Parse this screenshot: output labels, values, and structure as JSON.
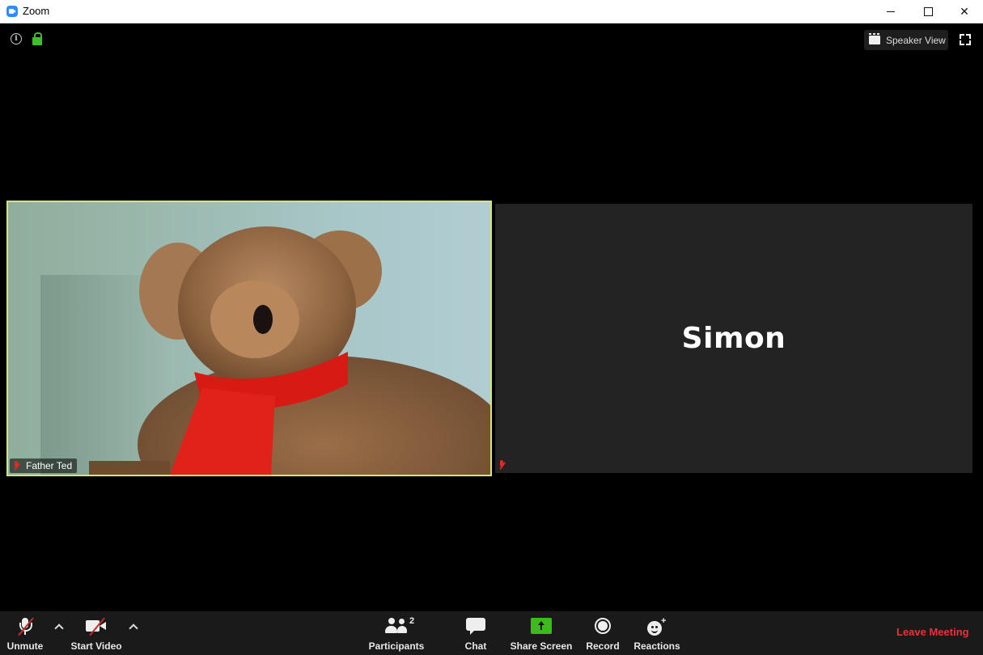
{
  "window": {
    "title": "Zoom",
    "controls": {
      "minimize": "minimize",
      "maximize": "maximize",
      "close": "close"
    }
  },
  "meeting_header": {
    "info_icon": "info-icon",
    "security_icon": "lock-icon",
    "view_toggle_label": "Speaker View",
    "fullscreen_icon": "fullscreen-icon"
  },
  "participants_tiles": [
    {
      "name": "Father Ted",
      "video_on": true,
      "muted": true,
      "active_speaker": true
    },
    {
      "name": "Simon",
      "video_on": false,
      "muted": true,
      "active_speaker": false
    }
  ],
  "toolbar": {
    "unmute_label": "Unmute",
    "start_video_label": "Start Video",
    "participants_label": "Participants",
    "participants_count": "2",
    "chat_label": "Chat",
    "share_screen_label": "Share Screen",
    "record_label": "Record",
    "reactions_label": "Reactions",
    "leave_label": "Leave Meeting"
  },
  "colors": {
    "active_speaker_border": "#d6e86c",
    "share_green": "#3dbb1d",
    "leave_red": "#e8323a",
    "muted_red": "#e02828",
    "lock_green": "#3fbf2a"
  }
}
